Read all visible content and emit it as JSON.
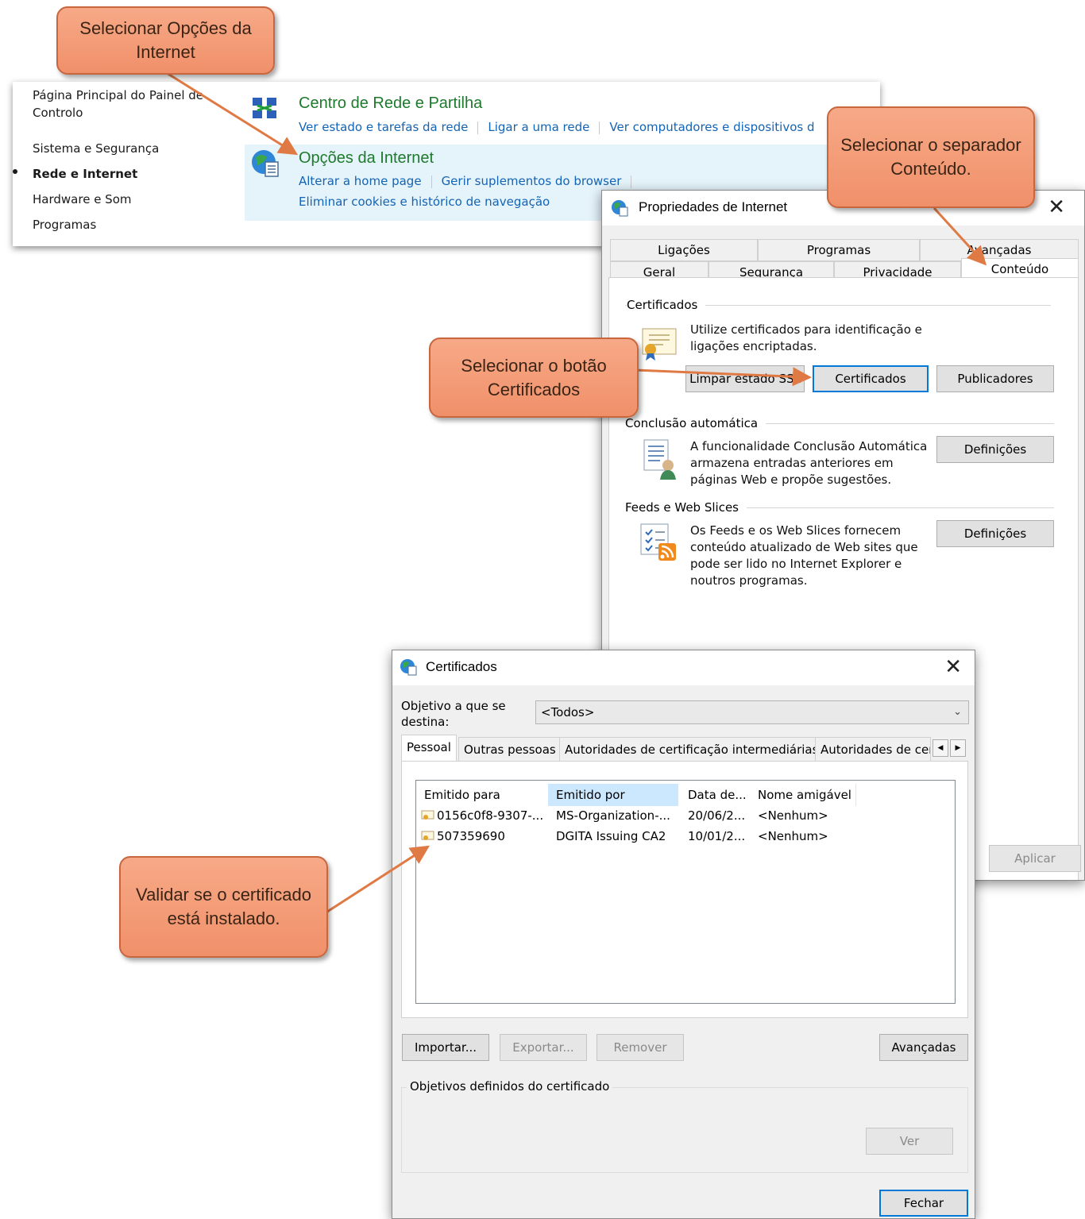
{
  "control_panel": {
    "sidebar": {
      "home_link": "Página Principal do Painel de Controlo",
      "items": [
        "Sistema e Segurança",
        "Rede e Internet",
        "Hardware e Som",
        "Programas"
      ]
    },
    "network_center": {
      "title": "Centro de Rede e Partilha",
      "links": [
        "Ver estado e tarefas da rede",
        "Ligar a uma rede",
        "Ver computadores e dispositivos d"
      ]
    },
    "internet_options": {
      "title": "Opções da Internet",
      "links": [
        "Alterar a home page",
        "Gerir suplementos do browser"
      ],
      "links2": [
        "Eliminar cookies e histórico de navegação"
      ]
    }
  },
  "internet_properties": {
    "title": "Propriedades de Internet",
    "close": "✕",
    "tabs_row1": [
      "Ligações",
      "Programas",
      "Avançadas"
    ],
    "tabs_row2": [
      "Geral",
      "Segurança",
      "Privacidade",
      "Conteúdo"
    ],
    "certificates": {
      "label": "Certificados",
      "description": "Utilize certificados para identificação e ligações encriptadas.",
      "buttons": [
        "Limpar estado SSL",
        "Certificados",
        "Publicadores"
      ]
    },
    "autocomplete": {
      "label": "Conclusão automática",
      "description": "A funcionalidade Conclusão Automática armazena entradas anteriores em páginas Web e propõe sugestões.",
      "button": "Definições"
    },
    "feeds": {
      "label": "Feeds e Web Slices",
      "description": "Os Feeds e os Web Slices fornecem conteúdo atualizado de Web sites que pode ser lido no Internet Explorer e noutros programas.",
      "button": "Definições"
    },
    "apply_button": "Aplicar"
  },
  "certificates_dialog": {
    "title": "Certificados",
    "close": "✕",
    "purpose_label": "Objetivo a que se destina:",
    "purpose_value": "<Todos>",
    "tabs": [
      "Pessoal",
      "Outras pessoas",
      "Autoridades de certificação intermediárias",
      "Autoridades de cer"
    ],
    "columns": [
      "Emitido para",
      "Emitido por",
      "Data de...",
      "Nome amigável"
    ],
    "rows": [
      {
        "issued_to": "0156c0f8-9307-...",
        "issued_by": "MS-Organization-...",
        "date": "20/06/2...",
        "name": "<Nenhum>"
      },
      {
        "issued_to": "507359690",
        "issued_by": "DGITA Issuing CA2",
        "date": "10/01/2...",
        "name": "<Nenhum>"
      }
    ],
    "buttons": {
      "import": "Importar...",
      "export": "Exportar...",
      "remove": "Remover",
      "advanced": "Avançadas",
      "view": "Ver",
      "close": "Fechar"
    },
    "purposes_label": "Objetivos definidos do certificado"
  },
  "callouts": {
    "internet_options": "Selecionar Opções da Internet",
    "content_tab": "Selecionar o separador Conteúdo.",
    "certificates_button": "Selecionar o botão Certificados",
    "validate": "Validar se o certificado está instalado."
  },
  "colors": {
    "accent": "#0078d7",
    "callout": "#f29a74",
    "link": "#1464b4",
    "cp_title": "#1e7a2c"
  }
}
